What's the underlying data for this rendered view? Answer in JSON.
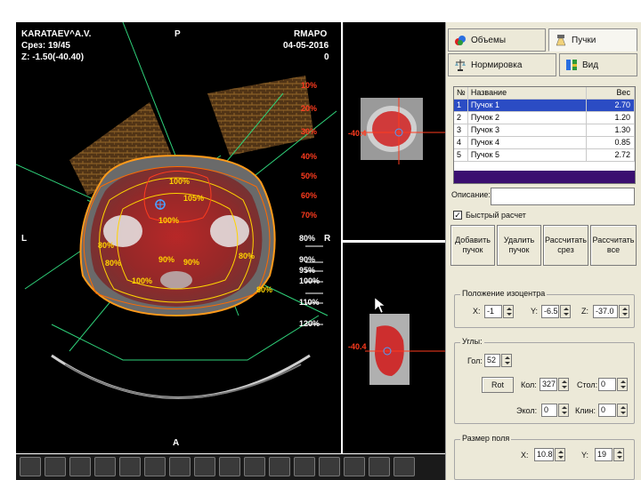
{
  "viewer": {
    "patient": "KARATAEV^A.V.",
    "slice": "Срез: 19/45",
    "z": "Z: -1.50(-40.40)",
    "orient_top": "P",
    "org": "RMAPO",
    "date": "04-05-2016",
    "zero": "0",
    "orient_left": "L",
    "orient_right": "R",
    "orient_bottom": "A",
    "right_isodoses": [
      "120%",
      "110%",
      "100%",
      "95%",
      "90%",
      "80%"
    ],
    "left_isodoses": [
      "50%",
      "40%",
      "30%",
      "20%",
      "10%",
      "70%",
      "60%"
    ],
    "inner_labels": [
      "100%",
      "105%",
      "100%",
      "80%",
      "80%",
      "80%",
      "90%",
      "90%",
      "100%",
      "80%"
    ],
    "sag_top_label": "-40.4",
    "sag_bot_label": "-40.4"
  },
  "tabs": {
    "volumes": "Объемы",
    "beams": "Пучки",
    "normalization": "Нормировка",
    "view": "Вид"
  },
  "table": {
    "headers": [
      "№",
      "Название",
      "Вес"
    ],
    "rows": [
      [
        "1",
        "Пучок 1",
        "2.70"
      ],
      [
        "2",
        "Пучок 2",
        "1.20"
      ],
      [
        "3",
        "Пучок 3",
        "1.30"
      ],
      [
        "4",
        "Пучок 4",
        "0.85"
      ],
      [
        "5",
        "Пучок 5",
        "2.72"
      ]
    ]
  },
  "form": {
    "info_label": "Описание:",
    "info_value": "",
    "fast_calc": "Быстрый расчет",
    "fast_calc_checked": "✓",
    "btn_add": "Добавить\nпучок",
    "btn_delete": "Удалить\nпучок",
    "btn_calc_slice": "Рассчитать\nсрез",
    "btn_calc_all": "Рассчитать\nвсе",
    "iso_group": "Положение изоцентра",
    "x_label": "X:",
    "x_value": "-1",
    "y_label": "Y:",
    "y_value": "-6.5",
    "z_label": "Z:",
    "z_value": "-37.0",
    "angles_group": "Углы:",
    "gantry_label": "Гол:",
    "gantry_value": "52",
    "rot_button": "Rot",
    "coll_label": "Кол:",
    "coll_value": "327",
    "table_label": "Стол:",
    "table_value": "0",
    "couch_label": "Экол:",
    "couch_value": "0",
    "wedge_label": "Клин:",
    "wedge_value": "0",
    "field_group": "Размер поля",
    "fx_label": "X:",
    "fx_value": "10.8",
    "fy_label": "Y:",
    "fy_value": "19"
  },
  "colors": {
    "selection": "#2b4cc4",
    "table_footer": "#3b0f70",
    "panel": "#ece9d8",
    "dose_red": "#ff3b1e",
    "dose_yellow": "#ffd400",
    "beam_green": "#2fd27a"
  }
}
